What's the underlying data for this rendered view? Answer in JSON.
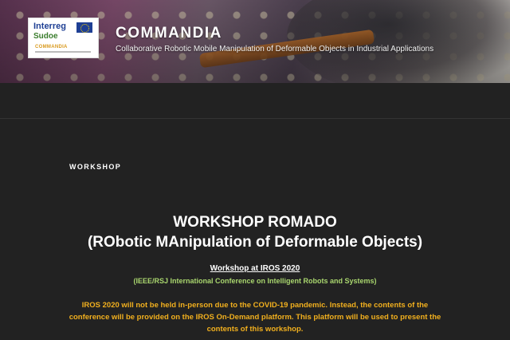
{
  "header": {
    "logo": {
      "line1": "Interreg",
      "line2": "Sudoe",
      "line3": "COMMANDIA"
    },
    "site_title": "COMMANDIA",
    "site_description": "Collaborative Robotic Mobile Manipulation of Deformable Objects in Industrial Applications"
  },
  "page": {
    "section_label": "WORKSHOP",
    "heading_main": "WORKSHOP ROMADO",
    "heading_sub": "(RObotic MAnipulation of Deformable Objects)",
    "link_text": "Workshop at IROS 2020",
    "conference_line": "(IEEE/RSJ International Conference on Intelligent Robots and Systems)",
    "notice": "IROS 2020 will not be held in-person due to the COVID-19 pandemic. Instead, the contents of the conference will be provided on the IROS On-Demand platform. This platform will be used to present the contents of this workshop."
  },
  "colors": {
    "background": "#222222",
    "green_text": "#a9d66e",
    "notice_text": "#f2b01e"
  }
}
